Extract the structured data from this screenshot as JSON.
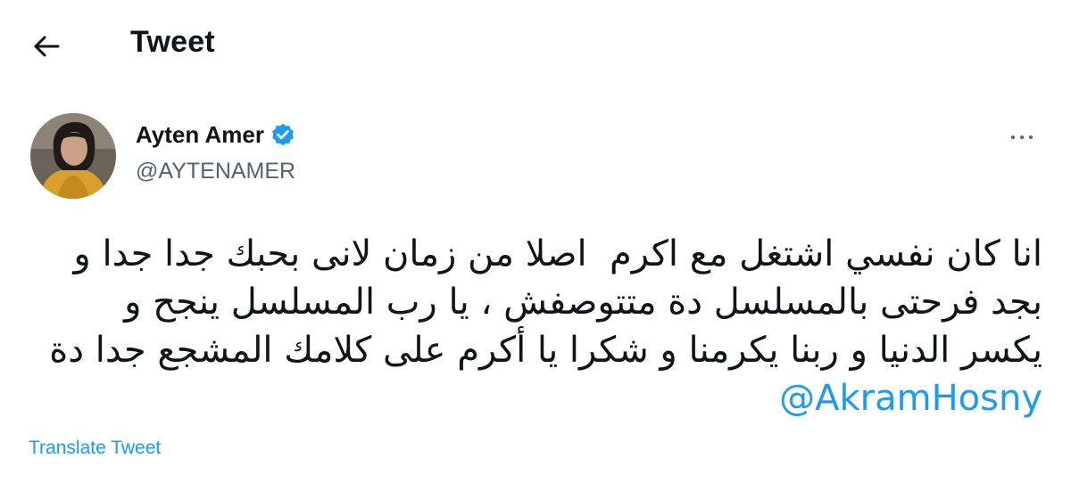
{
  "header": {
    "back_icon": "arrow-left-icon",
    "title": "Tweet"
  },
  "author": {
    "display_name": "Ayten Amer",
    "verified_icon": "verified-badge-icon",
    "verified_color": "#1d9bf0",
    "handle": "@AYTENAMER"
  },
  "menu": {
    "more_icon": "more-horizontal-icon"
  },
  "tweet": {
    "text": "انا كان نفسي اشتغل مع اكرم  اصلا من زمان لانى بحبك جدا جدا و بجد فرحتى بالمسلسل دة متتوصفش ، يا رب المسلسل ينجح و يكسر الدنيا و ربنا يكرمنا و شكرا يا أكرم على كلامك المشجع جدا دة ",
    "mention": "@AkramHosny"
  },
  "translate_label": "Translate Tweet",
  "colors": {
    "accent": "#1d9bf0",
    "text": "#0f1419",
    "muted": "#536471"
  }
}
